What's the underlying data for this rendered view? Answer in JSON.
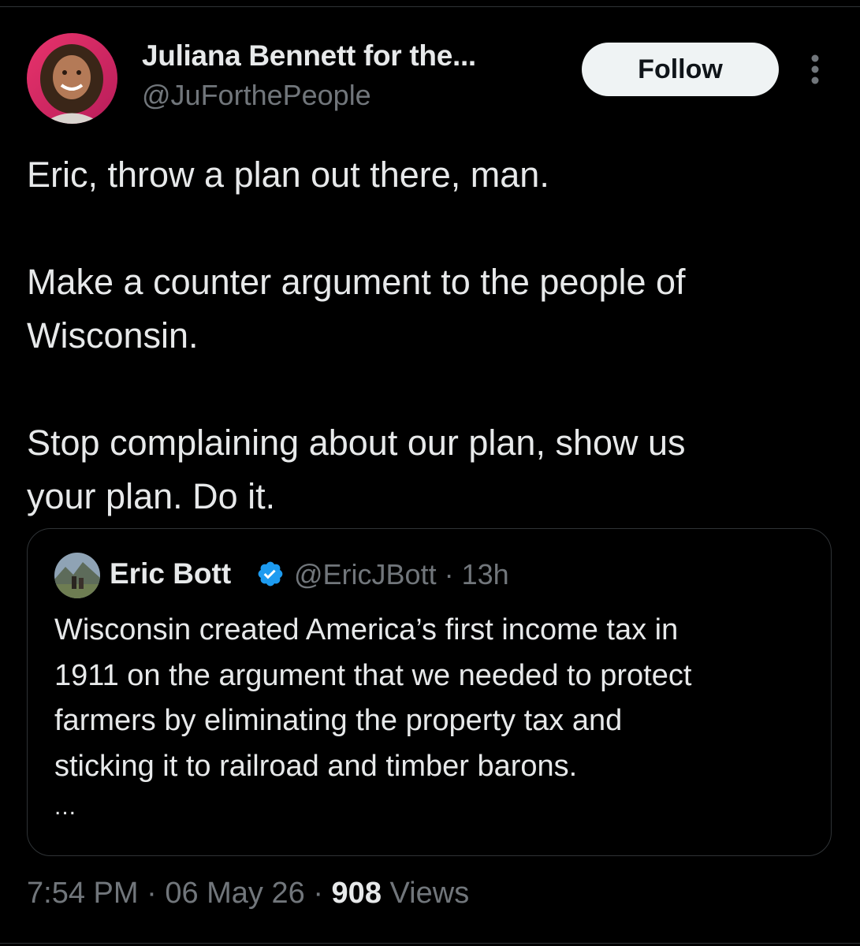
{
  "author": {
    "name": "Juliana Bennett for the...",
    "handle": "@JuForthePeople"
  },
  "follow_label": "Follow",
  "tweet": {
    "paragraphs": [
      "Eric, throw a plan out there, man.",
      "Make a counter argument to the people of\nWisconsin.",
      "Stop complaining about our plan, show us\nyour plan. Do it."
    ]
  },
  "quote": {
    "name": "Eric Bott",
    "handle": "@EricJBott",
    "separator": "·",
    "time": "13h",
    "lines": [
      "Wisconsin created America’s first income tax in",
      "1911 on the argument that we needed to protect",
      "farmers by eliminating the property tax and",
      "sticking it to railroad and timber barons."
    ],
    "ellipsis": "..."
  },
  "footer": {
    "time": "7:54 PM",
    "date": "06 May 26",
    "separator": "·",
    "views_count": "908",
    "views_label": "Views"
  },
  "icons": {
    "more": "more-vertical-icon",
    "verified": "verified-badge-icon"
  },
  "colors": {
    "background": "#000000",
    "text": "#e7e9ea",
    "secondary": "#71767b",
    "border": "#2f3336",
    "verified": "#1d9bf0",
    "follow_bg": "#eff3f4"
  }
}
